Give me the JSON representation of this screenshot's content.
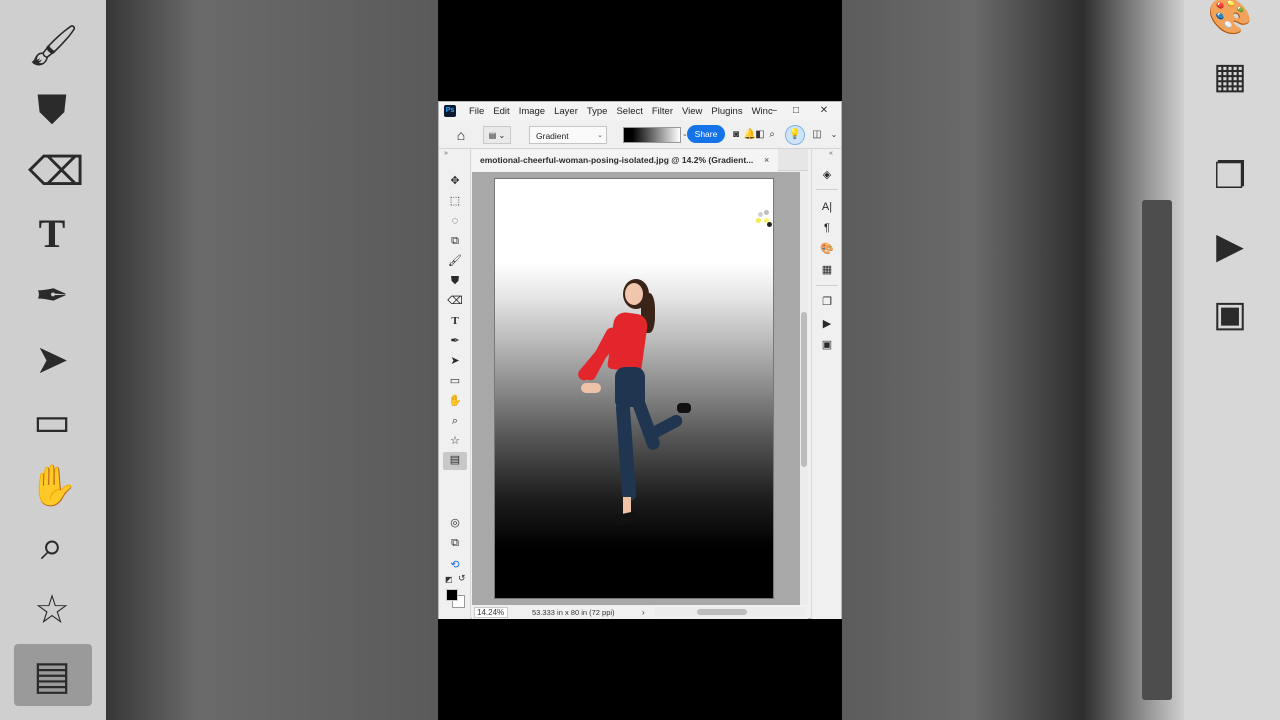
{
  "app": {
    "logo_text": "Ps",
    "menu": [
      "File",
      "Edit",
      "Image",
      "Layer",
      "Type",
      "Select",
      "Filter",
      "View",
      "Plugins",
      "Winc"
    ]
  },
  "window_controls": {
    "minimize": "–",
    "maximize": "□",
    "close": "✕"
  },
  "options_bar": {
    "home_icon": "home-icon",
    "gradient_mode": "Gradient",
    "share_label": "Share",
    "gradient_colors": [
      "#000000",
      "#ffffff"
    ]
  },
  "document": {
    "tab_title": "emotional-cheerful-woman-posing-isolated.jpg @ 14.2% (Gradient...",
    "tab_close": "×",
    "canvas_gradient": [
      "#ffffff",
      "#000000"
    ]
  },
  "status": {
    "zoom": "14.24%",
    "doc_info": "53.333 in x 80 in (72 ppi)",
    "arrow": "›"
  },
  "tools": [
    "move-icon",
    "marquee-icon",
    "lasso-icon",
    "object-select-icon",
    "brush-icon",
    "stamp-icon",
    "eraser-icon",
    "type-icon",
    "pen-icon",
    "path-select-icon",
    "rectangle-icon",
    "hand-icon",
    "zoom-icon",
    "star-icon",
    "gradient-icon"
  ],
  "right_panel_icons": [
    "layers-icon",
    "character-icon",
    "paragraph-icon",
    "color-palette-icon",
    "grid-icon",
    "layer-comps-icon",
    "play-actions-icon",
    "image-properties-icon"
  ],
  "colors": {
    "accent": "#1473e6",
    "foreground_swatch": "#000000",
    "background_swatch": "#ffffff"
  }
}
